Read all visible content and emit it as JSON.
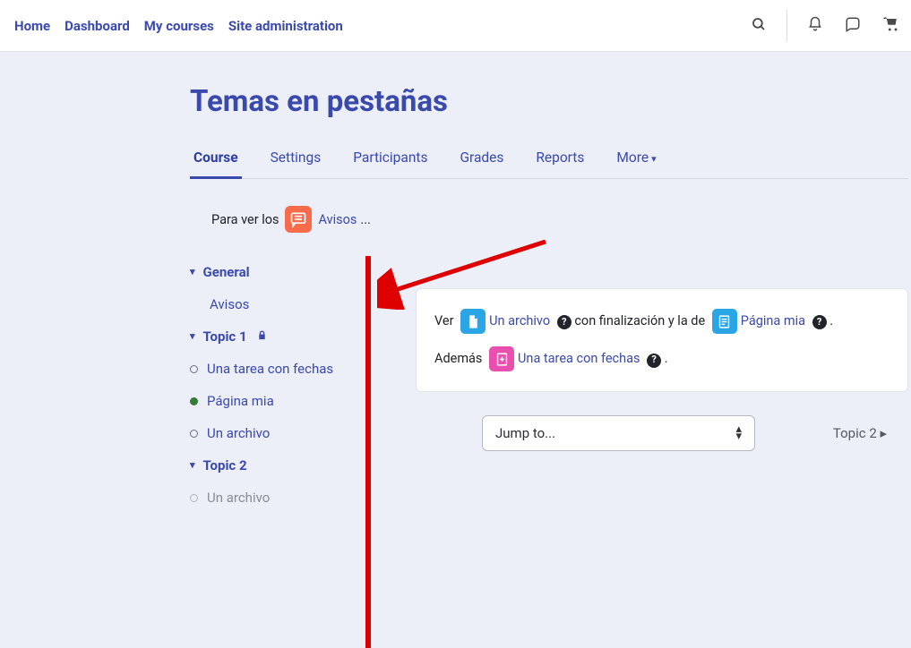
{
  "navbar": {
    "links": [
      "Home",
      "Dashboard",
      "My courses",
      "Site administration"
    ]
  },
  "page_title": "Temas en pestañas",
  "tabs": {
    "items": [
      "Course",
      "Settings",
      "Participants",
      "Grades",
      "Reports",
      "More"
    ]
  },
  "avisos": {
    "prefix": "Para ver los",
    "link": "Avisos",
    "suffix": "..."
  },
  "course_index": {
    "sections": [
      {
        "title": "General",
        "locked": false,
        "items": [
          {
            "label": "Avisos",
            "type": "plain"
          }
        ]
      },
      {
        "title": "Topic 1",
        "locked": true,
        "items": [
          {
            "label": "Una tarea con fechas",
            "type": "link",
            "completed": false
          },
          {
            "label": "Página mia",
            "type": "link",
            "completed": true
          },
          {
            "label": "Un archivo",
            "type": "link",
            "completed": false
          }
        ]
      },
      {
        "title": "Topic 2",
        "locked": false,
        "items": [
          {
            "label": "Un archivo",
            "type": "muted",
            "completed": false
          }
        ]
      }
    ]
  },
  "content": {
    "line1_prefix": "Ver",
    "file_link": "Un archivo",
    "line1_mid": "con finalización y la de",
    "page_link": "Página mia",
    "line1_end": ".",
    "line2_prefix": "Además",
    "assign_link": "Una tarea con fechas",
    "line2_end": "."
  },
  "jump": {
    "placeholder": "Jump to...",
    "next": "Topic 2"
  }
}
